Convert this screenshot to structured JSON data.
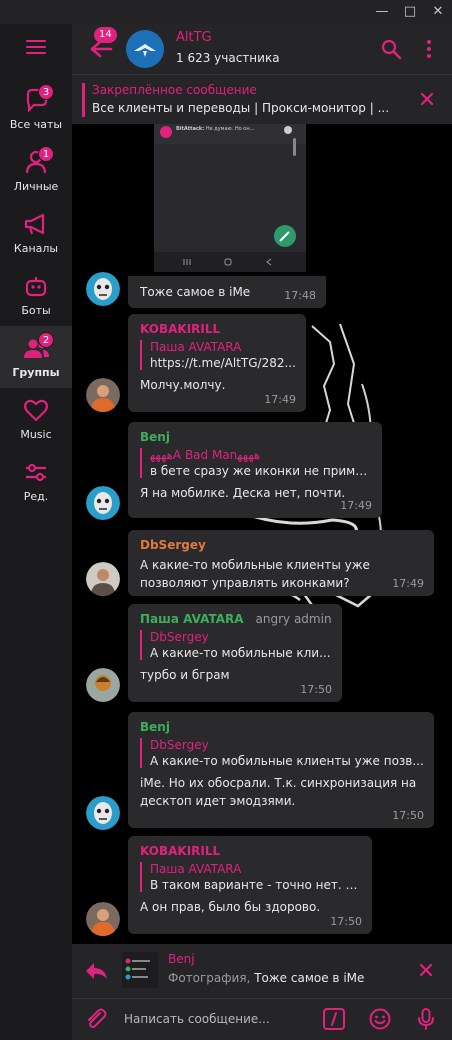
{
  "window": {
    "minimize": "—",
    "maximize": "□",
    "close": "✕"
  },
  "sidebar": {
    "folders": [
      {
        "label": "Все чаты",
        "badge": "3",
        "icon": "chat-bubble-icon"
      },
      {
        "label": "Личные",
        "badge": "1",
        "icon": "person-icon"
      },
      {
        "label": "Каналы",
        "badge": "",
        "icon": "megaphone-icon"
      },
      {
        "label": "Боты",
        "badge": "",
        "icon": "bot-icon"
      },
      {
        "label": "Группы",
        "badge": "2",
        "icon": "group-icon",
        "active": true
      },
      {
        "label": "Music",
        "badge": "",
        "icon": "heart-icon"
      },
      {
        "label": "Ред.",
        "badge": "",
        "icon": "sliders-icon"
      }
    ]
  },
  "header": {
    "back_badge": "14",
    "title": "AltTG",
    "subtitle": "1 623 участника"
  },
  "pinned": {
    "title": "Закреплённое сообщение",
    "text": "Все клиенты и переводы | Прокси-монитор | ..."
  },
  "chat": {
    "photo_preview": {
      "sender": "BitAttack:",
      "text": "Не думаю. Но он..."
    },
    "messages": [
      {
        "text": "Тоже самое в iMe",
        "time": "17:48"
      },
      {
        "sender": "KOBAKIRILL",
        "sender_color": "#e0217e",
        "reply_name": "Паша AVATARA",
        "reply_text": "https://t.me/AltTG/282...",
        "text": "Молчу.молчу.",
        "time": "17:49"
      },
      {
        "sender": "Benj",
        "sender_color": "#3fae5a",
        "reply_name": "ﻫﻬﻬﻬA Bad Manﻫﻬﻬﻬ",
        "reply_text": "в бете сразу же иконки не примен...",
        "text": "Я на мобилке. Деска нет, почти.",
        "time": "17:49"
      },
      {
        "sender": "DbSergey",
        "sender_color": "#e07a3a",
        "text": "А какие-то мобильные клиенты уже позволяют управлять иконками?",
        "time": "17:49"
      },
      {
        "sender": "Паша AVATARA",
        "sender_color": "#3fae5a",
        "role": "angry admin",
        "reply_name": "DbSergey",
        "reply_text": "А какие-то мобильные кли...",
        "text": "турбо и бграм",
        "time": "17:50"
      },
      {
        "sender": "Benj",
        "sender_color": "#3fae5a",
        "reply_name": "DbSergey",
        "reply_text": "А какие-то мобильные клиенты уже позв...",
        "text": "iMe. Но их обосрали. Т.к. синхронизация на десктоп идет эмодзями.",
        "time": "17:50"
      },
      {
        "sender": "KOBAKIRILL",
        "sender_color": "#e0217e",
        "reply_name": "Паша AVATARA",
        "reply_text": "В таком варианте - точно нет. В...",
        "text": "А он прав, было бы здорово.",
        "time": "17:50"
      }
    ]
  },
  "reply_preview": {
    "name": "Benj",
    "kind": "Фотография,",
    "text": "Тоже самое в iMe"
  },
  "compose": {
    "placeholder": "Написать сообщение..."
  },
  "colors": {
    "accent": "#e0217e",
    "green": "#3fae5a",
    "orange": "#e07a3a"
  }
}
